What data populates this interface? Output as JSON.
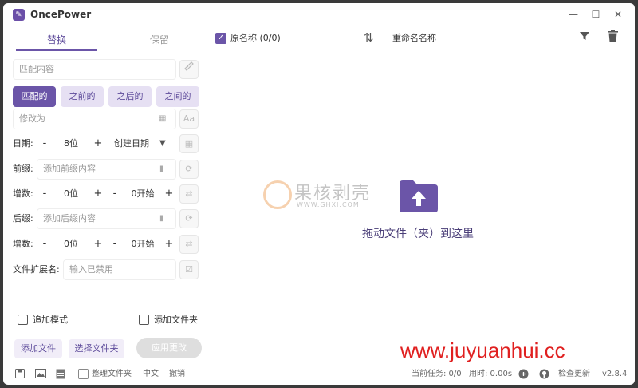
{
  "app": {
    "title": "OncePower",
    "logo_glyph": "✎"
  },
  "window_controls": {
    "minimize": "—",
    "maximize": "☐",
    "close": "✕"
  },
  "tabs": {
    "replace": "替换",
    "keep": "保留"
  },
  "match": {
    "placeholder": "匹配内容"
  },
  "modes": [
    "匹配的",
    "之前的",
    "之后的",
    "之间的"
  ],
  "modify": {
    "placeholder": "修改为",
    "case_icon_text": "Aa"
  },
  "date": {
    "label": "日期:",
    "minus": "-",
    "value": "8位",
    "plus": "+",
    "type": "创建日期"
  },
  "prefix": {
    "label": "前缀:",
    "placeholder": "添加前缀内容"
  },
  "inc1": {
    "label": "增数:",
    "minus": "-",
    "digits": "0位",
    "plus": "+",
    "minus2": "-",
    "start": "0开始",
    "plus2": "+"
  },
  "suffix": {
    "label": "后缀:",
    "placeholder": "添加后缀内容"
  },
  "inc2": {
    "label": "增数:",
    "minus": "-",
    "digits": "0位",
    "plus": "+",
    "minus2": "-",
    "start": "0开始",
    "plus2": "+"
  },
  "ext": {
    "label": "文件扩展名:",
    "placeholder": "输入已禁用"
  },
  "options": {
    "append_mode": "追加模式",
    "add_folder": "添加文件夹"
  },
  "actions": {
    "add_files": "添加文件",
    "select_folder": "选择文件夹",
    "apply": "应用更改"
  },
  "header": {
    "original_name": "原名称 (0/0)",
    "new_name": "重命名名称"
  },
  "drop": {
    "text": "拖动文件（夹）到这里"
  },
  "watermark": {
    "cn": "果核剥壳",
    "url": "WWW.GHXI.COM",
    "site": "www.juyuanhui.cc"
  },
  "footer": {
    "organize": "整理文件夹",
    "language": "中文",
    "undo": "撤销",
    "current_task": "当前任务: 0/0",
    "time_used": "用时: 0.00s",
    "check_update": "检查更新",
    "version": "v2.8.4"
  },
  "colors": {
    "accent": "#6b55a8",
    "accent_light": "#e6e0f3",
    "watermark_red": "#e02020"
  }
}
